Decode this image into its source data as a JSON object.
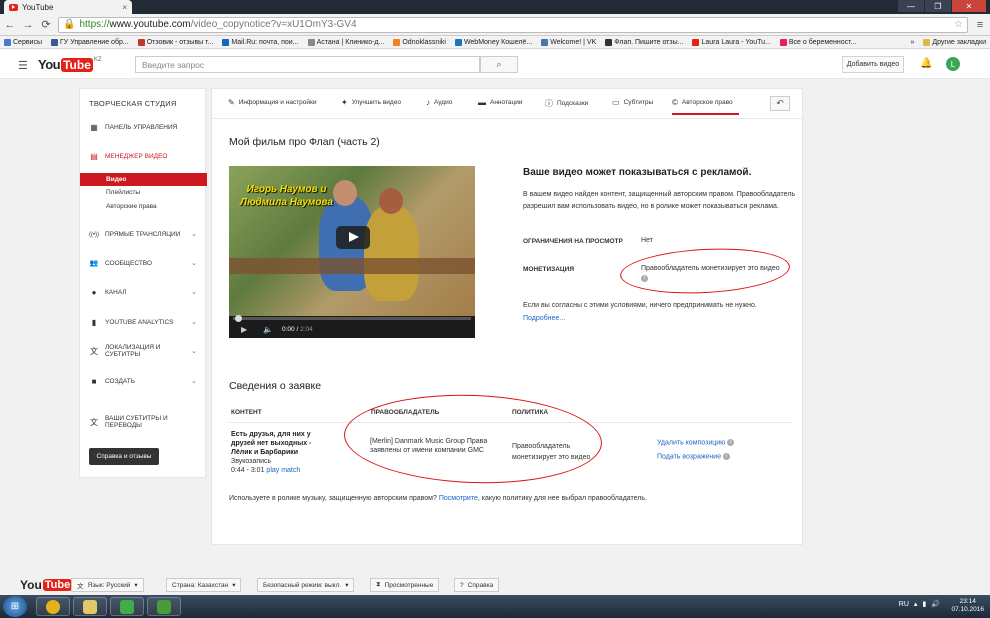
{
  "browser": {
    "tab_title": "YouTube",
    "tab_close": "×",
    "url_scheme": "https://",
    "url_host": "www.youtube.com",
    "url_path": "/video_copynotice?v=xU1OmY3-GV4",
    "window_controls": [
      "—",
      "❐",
      "✕"
    ],
    "bookmarks": [
      {
        "label": "Сервисы",
        "color": "#4a7bd0"
      },
      {
        "label": "ГУ Управление обр...",
        "color": "#3b5998"
      },
      {
        "label": "Отзовик - отзывы т...",
        "color": "#c0392b"
      },
      {
        "label": "Mail.Ru: почта, пои...",
        "color": "#1565c0"
      },
      {
        "label": "Астана | Клинико-д...",
        "color": "#888888"
      },
      {
        "label": "Odnoklassniki",
        "color": "#f58220"
      },
      {
        "label": "WebMoney Кошелё...",
        "color": "#1e73be"
      },
      {
        "label": "Welcome! | VK",
        "color": "#4a76a8"
      },
      {
        "label": "Флап. Пишите отзы...",
        "color": "#333333"
      },
      {
        "label": "Laura Laura - YouTu...",
        "color": "#e62117"
      },
      {
        "label": "Все о беременност...",
        "color": "#e91e63"
      }
    ],
    "bookmarks_more": "»",
    "other_bookmarks": "Другие закладки"
  },
  "header": {
    "logo_you": "You",
    "logo_tube": "Tube",
    "logo_region": "KZ",
    "search_placeholder": "Введите запрос",
    "upload_label": "Добавить видео",
    "avatar_letter": "L"
  },
  "sidebar": {
    "title": "ТВОРЧЕСКАЯ СТУДИЯ",
    "items": [
      {
        "label": "ПАНЕЛЬ УПРАВЛЕНИЯ",
        "icon": "▦"
      },
      {
        "label": "МЕНЕДЖЕР ВИДЕО",
        "icon": "▤"
      },
      {
        "label": "ПРЯМЫЕ ТРАНСЛЯЦИИ",
        "icon": "((•))"
      },
      {
        "label": "СООБЩЕСТВО",
        "icon": "👥"
      },
      {
        "label": "КАНАЛ",
        "icon": "●"
      },
      {
        "label": "YOUTUBE ANALYTICS",
        "icon": "▮"
      },
      {
        "label": "ЛОКАЛИЗАЦИЯ И СУБТИТРЫ",
        "icon": "文"
      },
      {
        "label": "СОЗДАТЬ",
        "icon": "■"
      },
      {
        "label": "ВАШИ СУБТИТРЫ И ПЕРЕВОДЫ",
        "icon": "文"
      }
    ],
    "subitems": [
      "Видео",
      "Плейлисты",
      "Авторские права"
    ],
    "help_button": "Справка и отзывы"
  },
  "tabs": [
    {
      "label": "Информация и настройки",
      "icon": "✎"
    },
    {
      "label": "Улучшить видео",
      "icon": "✦"
    },
    {
      "label": "Аудио",
      "icon": "♪"
    },
    {
      "label": "Аннотации",
      "icon": "▬"
    },
    {
      "label": "Подсказки",
      "icon": "ⓘ"
    },
    {
      "label": "Субтитры",
      "icon": "▭"
    },
    {
      "label": "Авторское право",
      "icon": "©"
    }
  ],
  "back_icon": "↶",
  "video": {
    "title": "Мой фильм про Флап (часть 2)",
    "overlay_caption": "Игорь Наумов и Людмила Наумова",
    "current_time": "0:00",
    "total_time": "2:04",
    "progress": 0
  },
  "ad": {
    "heading": "Ваше видео может показываться с рекламой.",
    "body": "В вашем видео найден контент, защищенный авторским правом. Правообладатель разрешил вам использовать видео, но в ролике может показываться реклама.",
    "restriction_label": "ОГРАНИЧЕНИЯ НА ПРОСМОТР",
    "restriction_value": "Нет",
    "monetization_label": "МОНЕТИЗАЦИЯ",
    "monetization_value": "Правообладатель монетизирует это видео",
    "agree_text": "Если вы согласны с этими условиями, ничего предпринимать не нужно.",
    "more_link": "Подробнее..."
  },
  "claim": {
    "title": "Сведения о заявке",
    "headers": [
      "КОНТЕНТ",
      "ПРАВООБЛАДАТЕЛЬ",
      "ПОЛИТИКА"
    ],
    "content_title": "Есть друзья, для них у друзей нет выходных - Лёлик и Барбарики",
    "content_type": "Звукозапись",
    "content_range": "0:44 - 3:01",
    "play_match": "play match",
    "owner": "[Merlin] Danmark Music Group Права заявлены от имени компании GMC",
    "policy": "Правообладатель монетизирует это видео",
    "action_remove": "Удалить композицию",
    "action_dispute": "Подать возражение",
    "music_note_before": "Используете в ролике музыку, защищенную авторским правом?",
    "music_note_link": "Посмотрите",
    "music_note_after": ", какую политику для нее выбрал правообладатель."
  },
  "footer": {
    "logo_you": "You",
    "logo_tube": "Tube",
    "language": "Язык: Русский",
    "country": "Страна: Казахстан",
    "safe_mode": "Безопасный режим: выкл.",
    "history": "Просмотренные",
    "help": "Справка"
  },
  "taskbar": {
    "lang": "RU",
    "time": "23:14",
    "date": "07.10.2016",
    "apps": [
      {
        "name": "chrome",
        "color": "#e3b21c"
      },
      {
        "name": "explorer",
        "color": "#e2c76b"
      },
      {
        "name": "app-a",
        "color": "#3fae49"
      },
      {
        "name": "utorrent",
        "color": "#4b9a3a"
      }
    ]
  },
  "colors": {
    "accent_red": "#cc181e",
    "link_blue": "#1a65c9",
    "annotation_red": "#dd1111"
  }
}
